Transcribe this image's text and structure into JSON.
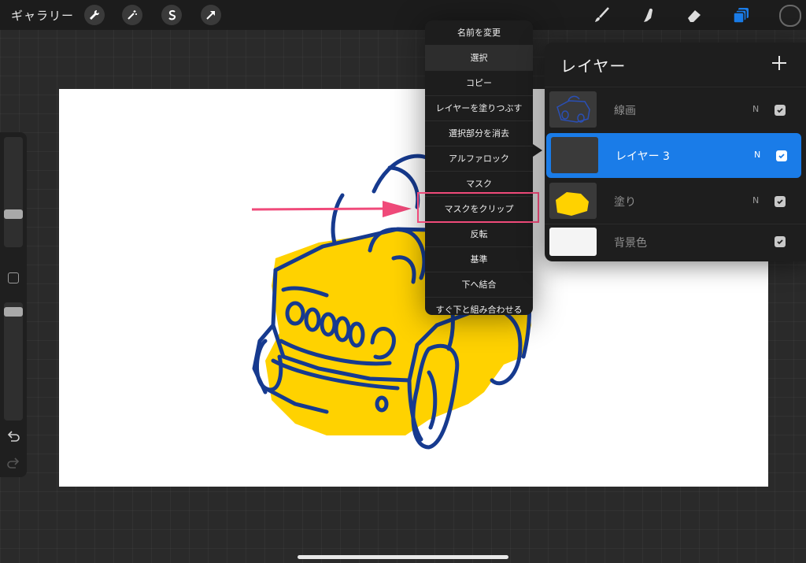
{
  "topbar": {
    "gallery_label": "ギャラリー",
    "left_tools": [
      "wrench-icon",
      "magic-wand-icon",
      "selection-s-icon",
      "transform-arrow-icon"
    ],
    "right_tools": [
      "brush-icon",
      "smudge-icon",
      "eraser-icon",
      "layers-icon"
    ],
    "active_tool": "layers-icon",
    "accent_color": "#1a7ce8"
  },
  "context_menu": {
    "items": [
      "名前を変更",
      "選択",
      "コピー",
      "レイヤーを塗りつぶす",
      "選択部分を消去",
      "アルファロック",
      "マスク",
      "マスクをクリップ",
      "反転",
      "基準",
      "下へ結合",
      "すぐ下と組み合わせる"
    ],
    "highlighted_index": 7,
    "highlight_color": "#f04a7a"
  },
  "layers_panel": {
    "title": "レイヤー",
    "add_icon": "plus-icon",
    "layers": [
      {
        "name": "線画",
        "blend": "N",
        "visible": true,
        "selected": false
      },
      {
        "name": "レイヤー 3",
        "blend": "N",
        "visible": true,
        "selected": true
      },
      {
        "name": "塗り",
        "blend": "N",
        "visible": true,
        "selected": false
      },
      {
        "name": "背景色",
        "blend": "",
        "visible": true,
        "selected": false
      }
    ]
  },
  "colors": {
    "line_art": "#163a8f",
    "fill": "#ffd200",
    "annotation_arrow": "#f04a7a"
  }
}
